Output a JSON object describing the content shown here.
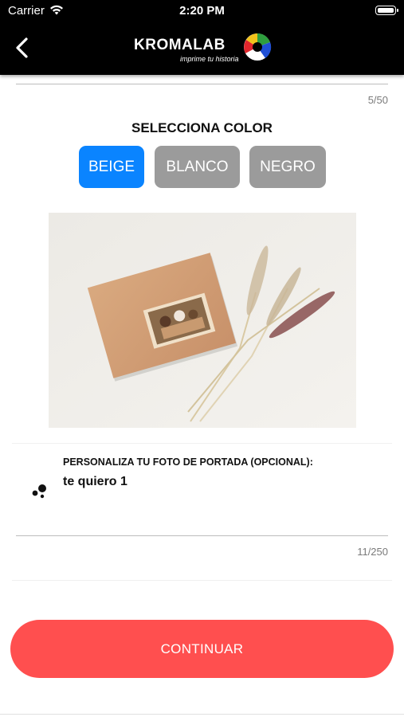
{
  "status_bar": {
    "carrier": "Carrier",
    "time": "2:20 PM"
  },
  "header": {
    "logo_text": "KROMALAB",
    "logo_tagline": "imprime tu historia"
  },
  "top_field": {
    "counter": "5/50"
  },
  "color_select": {
    "title": "SELECCIONA COLOR",
    "options": [
      {
        "label": "BEIGE",
        "selected": true,
        "color": "#0a84ff"
      },
      {
        "label": "BLANCO",
        "selected": false,
        "color": "#9b9b9b"
      },
      {
        "label": "NEGRO",
        "selected": false,
        "color": "#9b9b9b"
      }
    ]
  },
  "cover_field": {
    "label": "PERSONALIZA TU FOTO DE PORTADA (OPCIONAL):",
    "value": "te quiero 1",
    "counter": "11/250"
  },
  "continue_button": {
    "label": "CONTINUAR",
    "color": "#ff4f4f"
  }
}
